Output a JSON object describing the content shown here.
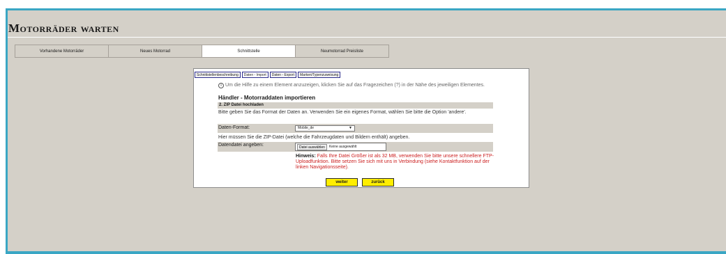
{
  "app": {
    "title": "Motorräder warten"
  },
  "nav": {
    "tabs": [
      {
        "label": "Vorhandene Motorräder"
      },
      {
        "label": "Neues Motorrad"
      },
      {
        "label": "Schnittstelle"
      },
      {
        "label": "Neumotorrad Preisliste"
      }
    ],
    "active": "Schnittstelle"
  },
  "subnav": {
    "tabs": [
      {
        "label": "Schnittstellenbeschreibung"
      },
      {
        "label": "Daten - Import"
      },
      {
        "label": "Daten - Export"
      },
      {
        "label": "Marken/Typenzuweisung"
      }
    ],
    "active": "Daten - Import"
  },
  "help": {
    "text": "Um die Hilfe zu einem Element anzuzeigen, klicken Sie auf das Fragezeichen (?) in der Nähe des jeweiligen Elementes.",
    "icon": "info-icon"
  },
  "form": {
    "heading": "Händler - Motorraddaten importieren",
    "section": "2. ZIP Datei hochladen",
    "format_intro": "Bitte geben Sie das Format der Daten an. Verwenden Sie ein eigenes Format, wählen Sie bitte die Option 'andere'.",
    "format_label": "Daten-Format:",
    "format_value": "Mobile_de",
    "zip_intro": "Hier müssen Sie die ZIP-Datei (welche die Fahrzeugdaten und Bildern enthält) angeben.",
    "file_label": "Datendatei angeben:",
    "file_button": "Datei auswählen",
    "file_status": "Keine ausgewählt",
    "hint_label": "Hinweis:",
    "hint_text": " Falls Ihre Datei Größer ist als 32 MB, verwenden Sie bitte unsere schnellere FTP-Uploadfunktion. Bitte setzen Sie sich mit uns in Verbindung (siehe Kontaktfunktion auf der linken Navigationsseite).",
    "next_label": "weiter",
    "back_label": "zurück"
  },
  "colors": {
    "accent": "#3aa6c4",
    "button": "#ffee00",
    "hint": "#cc2020",
    "background": "#d4d0c8"
  }
}
